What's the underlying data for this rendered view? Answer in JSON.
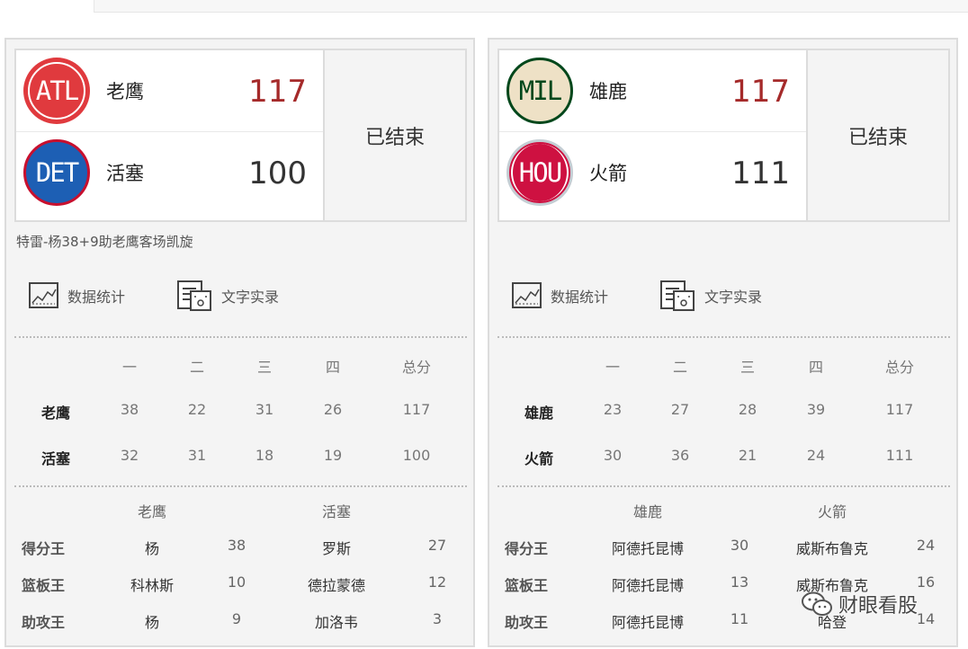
{
  "games": [
    {
      "status": "已结束",
      "headline": "特雷-杨38+9助老鹰客场凯旋",
      "links": {
        "stats": "数据统计",
        "live": "文字实录"
      },
      "teams": [
        {
          "abbr": "ATL",
          "name": "老鹰",
          "score": "117",
          "logo_bg": "#e03a3e",
          "logo_ring": "#ffffff",
          "logo_fg": "#ffffff",
          "score_color": "#a52a2a"
        },
        {
          "abbr": "DET",
          "name": "活塞",
          "score": "100",
          "logo_bg": "#1d5fb4",
          "logo_ring": "#c8102e",
          "logo_fg": "#ffffff",
          "score_color": "#333333"
        }
      ],
      "quarters": {
        "headers": [
          "一",
          "二",
          "三",
          "四",
          "总分"
        ],
        "rows": [
          {
            "team": "老鹰",
            "values": [
              "38",
              "22",
              "31",
              "26",
              "117"
            ]
          },
          {
            "team": "活塞",
            "values": [
              "32",
              "31",
              "18",
              "19",
              "100"
            ]
          }
        ]
      },
      "leaders": {
        "team_headers": [
          "老鹰",
          "活塞"
        ],
        "rows": [
          {
            "category": "得分王",
            "a_name": "杨",
            "a_val": "38",
            "b_name": "罗斯",
            "b_val": "27"
          },
          {
            "category": "篮板王",
            "a_name": "科林斯",
            "a_val": "10",
            "b_name": "德拉蒙德",
            "b_val": "12"
          },
          {
            "category": "助攻王",
            "a_name": "杨",
            "a_val": "9",
            "b_name": "加洛韦",
            "b_val": "3"
          }
        ]
      }
    },
    {
      "status": "已结束",
      "headline": "",
      "links": {
        "stats": "数据统计",
        "live": "文字实录"
      },
      "teams": [
        {
          "abbr": "MIL",
          "name": "雄鹿",
          "score": "117",
          "logo_bg": "#eee1c6",
          "logo_ring": "#00471b",
          "logo_fg": "#00471b",
          "score_color": "#a52a2a"
        },
        {
          "abbr": "HOU",
          "name": "火箭",
          "score": "111",
          "logo_bg": "#ce1141",
          "logo_ring": "#c4ced4",
          "logo_fg": "#ffffff",
          "score_color": "#333333"
        }
      ],
      "quarters": {
        "headers": [
          "一",
          "二",
          "三",
          "四",
          "总分"
        ],
        "rows": [
          {
            "team": "雄鹿",
            "values": [
              "23",
              "27",
              "28",
              "39",
              "117"
            ]
          },
          {
            "team": "火箭",
            "values": [
              "30",
              "36",
              "21",
              "24",
              "111"
            ]
          }
        ]
      },
      "leaders": {
        "team_headers": [
          "雄鹿",
          "火箭"
        ],
        "rows": [
          {
            "category": "得分王",
            "a_name": "阿德托昆博",
            "a_val": "30",
            "b_name": "威斯布鲁克",
            "b_val": "24"
          },
          {
            "category": "篮板王",
            "a_name": "阿德托昆博",
            "a_val": "13",
            "b_name": "威斯布鲁克",
            "b_val": "16"
          },
          {
            "category": "助攻王",
            "a_name": "阿德托昆博",
            "a_val": "11",
            "b_name": "哈登",
            "b_val": "14"
          }
        ]
      }
    }
  ],
  "watermark": {
    "text": "财眼看股",
    "icon": "wechat-icon"
  }
}
